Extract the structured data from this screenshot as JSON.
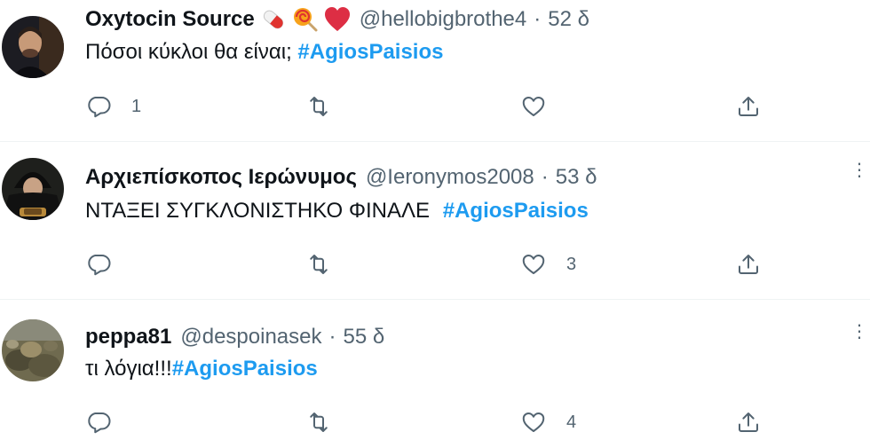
{
  "tweets": [
    {
      "display_name": "Oxytocin Source",
      "emojis": [
        "pill-emoji",
        "lollipop-emoji",
        "red-heart-emoji"
      ],
      "handle": "@hellobigbrothe4",
      "separator": "·",
      "time": "52 δ",
      "text": "Πόσοι κύκλοι θα είναι;",
      "hashtag": "#AgiosPaisios",
      "reply_count": "1",
      "retweet_count": "",
      "like_count": ""
    },
    {
      "display_name": "Αρχιεπίσκοπος Ιερώνυμος",
      "handle": "@Ieronymos2008",
      "separator": "·",
      "time": "53 δ",
      "text": "ΝΤΑΞΕΙ ΣΥΓΚΛΟΝΙΣΤΗΚΟ ΦΙΝΑΛΕ",
      "hashtag": "#AgiosPaisios",
      "reply_count": "",
      "retweet_count": "",
      "like_count": "3"
    },
    {
      "display_name": "peppa81",
      "handle": "@despoinasek",
      "separator": "·",
      "time": "55 δ",
      "text": "τι λόγια!!!",
      "hashtag": "#AgiosPaisios",
      "reply_count": "",
      "retweet_count": "",
      "like_count": "4"
    }
  ],
  "icons": {
    "reply": "reply-icon",
    "retweet": "retweet-icon",
    "like": "like-icon",
    "share": "share-icon",
    "more": "more-icon"
  },
  "colors": {
    "hashtag": "#1d9bf0",
    "secondary_text": "#536471",
    "primary_text": "#0f1419",
    "divider": "#eff3f4"
  }
}
